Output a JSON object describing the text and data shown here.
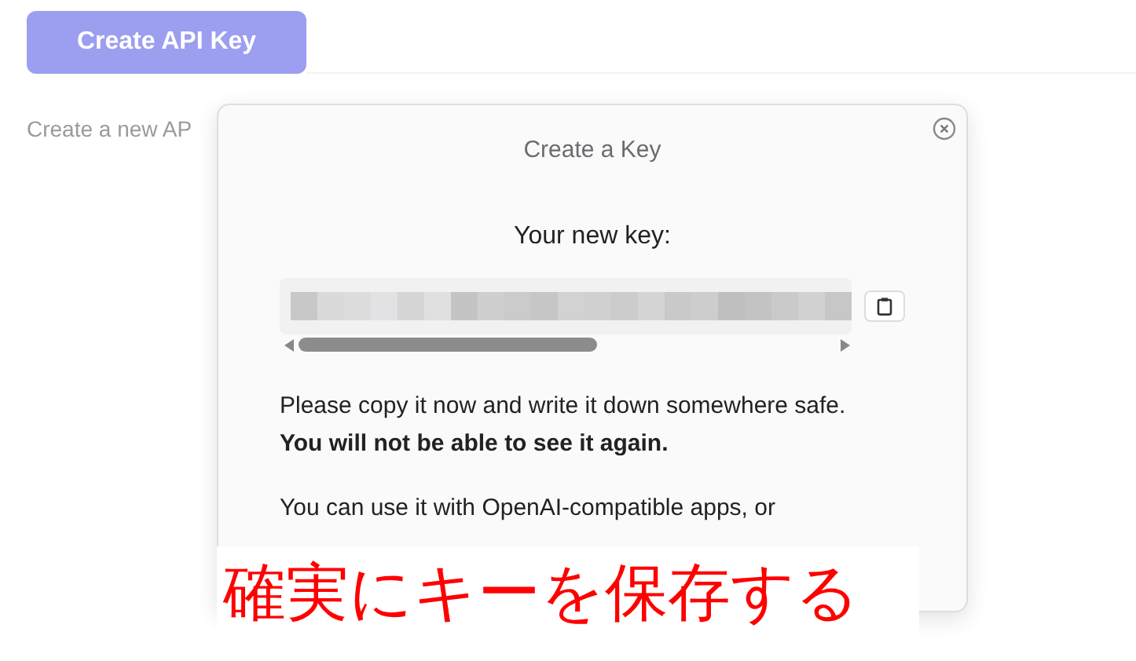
{
  "page": {
    "create_button": "Create API Key",
    "description": "Create a new AP"
  },
  "dialog": {
    "title": "Create a Key",
    "key_label": "Your new key:",
    "notice": "Please copy it now and write it down somewhere safe. **You will not be able to see it again.**",
    "usage_text": "You can use it with OpenAI-compatible apps, or"
  },
  "caption": "確実にキーを保存する"
}
